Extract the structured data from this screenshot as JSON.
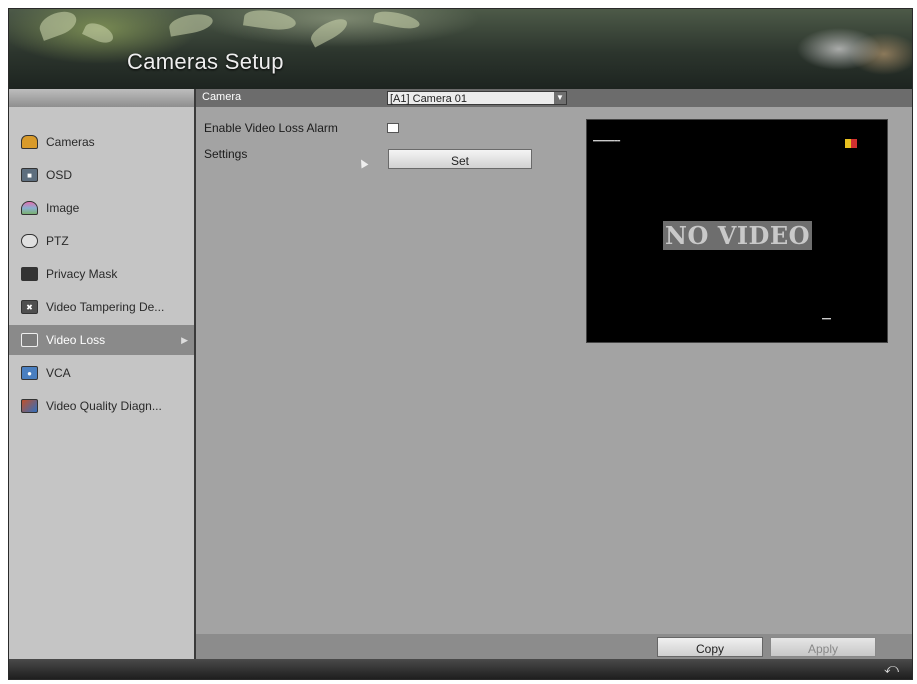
{
  "header": {
    "title": "Cameras Setup"
  },
  "camera_row": {
    "label": "Camera",
    "selected": "[A1] Camera 01"
  },
  "sidebar": {
    "items": [
      {
        "label": "Cameras",
        "icon": "camera-icon",
        "color": "#d89a2a"
      },
      {
        "label": "OSD",
        "icon": "osd-icon",
        "color": "#5d6e7e"
      },
      {
        "label": "Image",
        "icon": "image-icon",
        "color": "#8ab0d0"
      },
      {
        "label": "PTZ",
        "icon": "ptz-icon",
        "color": "#e0e0e0"
      },
      {
        "label": "Privacy Mask",
        "icon": "privacy-mask-icon",
        "color": "#333333"
      },
      {
        "label": "Video Tampering De...",
        "icon": "video-tampering-icon",
        "color": "#4f4f4f"
      },
      {
        "label": "Video Loss",
        "icon": "video-loss-icon",
        "color": "#7c7c7c",
        "active": true
      },
      {
        "label": "VCA",
        "icon": "vca-icon",
        "color": "#4a7fc0"
      },
      {
        "label": "Video Quality Diagn...",
        "icon": "video-quality-icon",
        "color": "#c0502a"
      }
    ]
  },
  "settings": {
    "enable_label": "Enable Video Loss Alarm",
    "enable_checked": false,
    "settings_label": "Settings",
    "set_button": "Set"
  },
  "preview": {
    "no_video": "NO VIDEO"
  },
  "footer": {
    "copy_button": "Copy",
    "apply_button": "Apply",
    "back_icon": "back-icon"
  }
}
